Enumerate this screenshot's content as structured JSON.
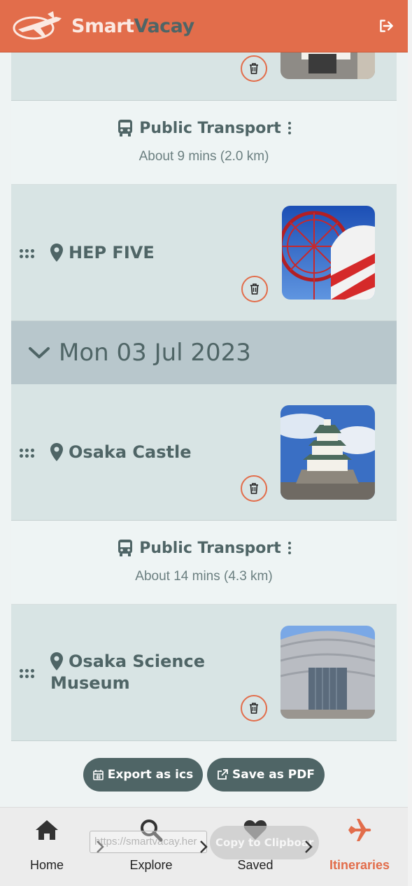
{
  "app": {
    "brand_part1": "Smart",
    "brand_part2": "Vacay",
    "accent_color": "#e26d4b",
    "primary_color": "#4f6566"
  },
  "header": {
    "logout_icon": "sign-out-icon"
  },
  "itinerary": {
    "transport_1": {
      "title": "Public Transport",
      "subtitle": "About 9 mins (2.0 km)"
    },
    "place_hep": {
      "name": "HEP FIVE"
    },
    "day_2": {
      "label": "Mon 03 Jul 2023"
    },
    "place_castle": {
      "name": "Osaka Castle"
    },
    "transport_2": {
      "title": "Public Transport",
      "subtitle": "About 14 mins (4.3 km)"
    },
    "place_museum": {
      "name_line1": "Osaka Science",
      "name_line2": "Museum"
    }
  },
  "actions": {
    "export_ics": "Export as ics",
    "save_pdf": "Save as PDF"
  },
  "share_overlay": {
    "url_value": "https://smartvacay.her",
    "copy_label": "Copy to Clipboar"
  },
  "nav": {
    "home": "Home",
    "explore": "Explore",
    "saved": "Saved",
    "itineraries": "Itineraries"
  }
}
